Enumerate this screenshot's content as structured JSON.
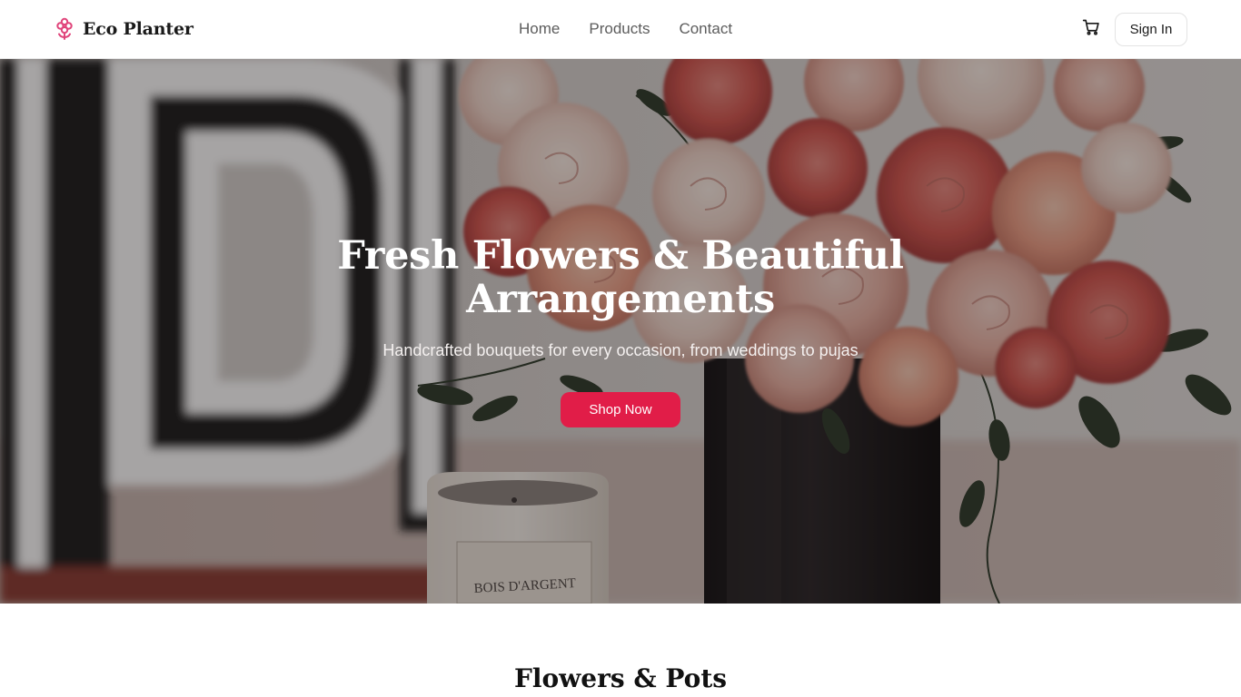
{
  "header": {
    "brand_name": "Eco Planter",
    "brand_icon": "flower-icon",
    "nav": [
      {
        "label": "Home"
      },
      {
        "label": "Products"
      },
      {
        "label": "Contact"
      }
    ],
    "cart_icon": "shopping-cart-icon",
    "sign_in_label": "Sign In"
  },
  "hero": {
    "title": "Fresh Flowers & Beautiful Arrangements",
    "subtitle": "Handcrafted bouquets for every occasion, from weddings to pujas",
    "cta_label": "Shop Now",
    "candle_label": "BOIS D'ARGENT"
  },
  "section": {
    "title": "Flowers & Pots"
  },
  "colors": {
    "accent": "#e11d48",
    "brand_icon": "#e0457b",
    "text": "#111111",
    "nav_text": "#5c5c5c"
  }
}
